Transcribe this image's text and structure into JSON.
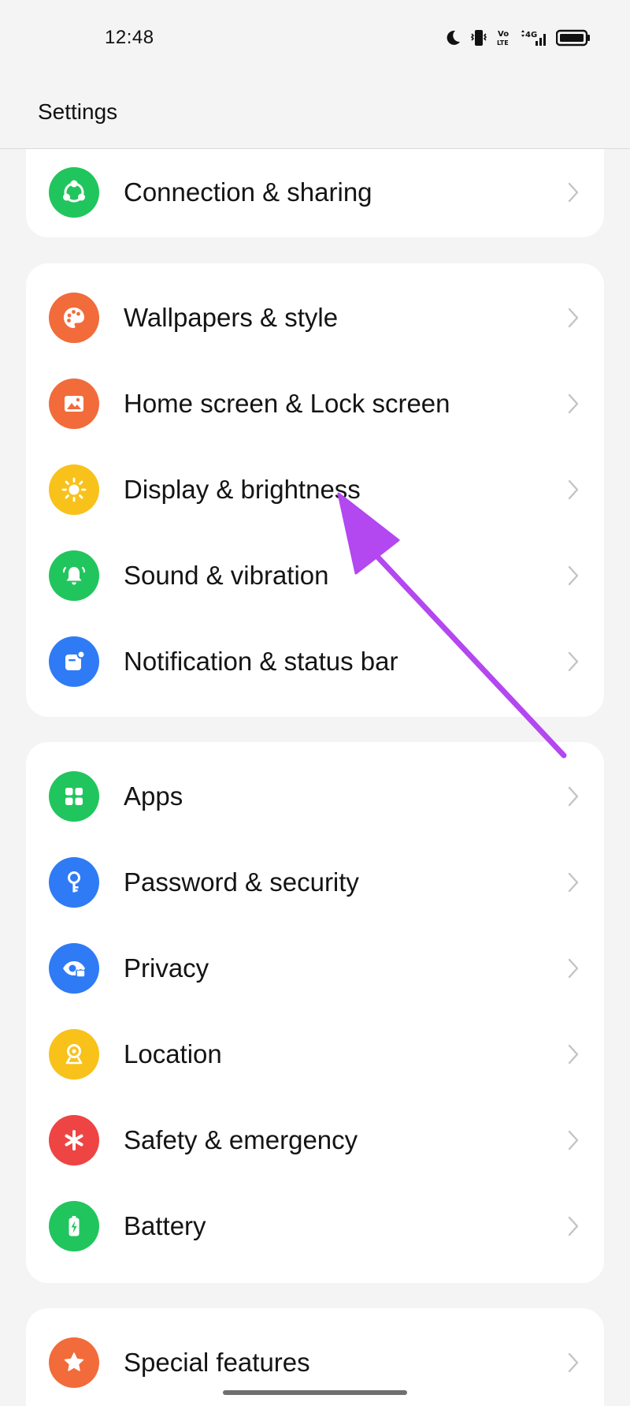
{
  "status_bar": {
    "time": "12:48",
    "icons": [
      "moon-icon",
      "vibrate-icon",
      "volte-icon",
      "signal-4g-icon",
      "battery-icon"
    ],
    "volte_text": "Vo\nLTE",
    "network_text": "4G"
  },
  "header": {
    "title": "Settings"
  },
  "groups": [
    {
      "items": [
        {
          "label": "Connection & sharing",
          "icon": "connection-sharing-icon",
          "color": "#21c55d"
        }
      ]
    },
    {
      "items": [
        {
          "label": "Wallpapers & style",
          "icon": "palette-icon",
          "color": "#f26b3a"
        },
        {
          "label": "Home screen & Lock screen",
          "icon": "image-icon",
          "color": "#f26b3a"
        },
        {
          "label": "Display & brightness",
          "icon": "sun-icon",
          "color": "#f8c21b"
        },
        {
          "label": "Sound & vibration",
          "icon": "bell-icon",
          "color": "#21c55d"
        },
        {
          "label": "Notification & status bar",
          "icon": "notification-icon",
          "color": "#2f7bf5"
        }
      ]
    },
    {
      "items": [
        {
          "label": "Apps",
          "icon": "apps-grid-icon",
          "color": "#21c55d"
        },
        {
          "label": "Password & security",
          "icon": "key-icon",
          "color": "#2f7bf5"
        },
        {
          "label": "Privacy",
          "icon": "eye-lock-icon",
          "color": "#2f7bf5"
        },
        {
          "label": "Location",
          "icon": "location-pin-icon",
          "color": "#f8c21b"
        },
        {
          "label": "Safety & emergency",
          "icon": "asterisk-icon",
          "color": "#ee4444"
        },
        {
          "label": "Battery",
          "icon": "battery-charge-icon",
          "color": "#21c55d"
        }
      ]
    },
    {
      "items": [
        {
          "label": "Special features",
          "icon": "star-icon",
          "color": "#f26b3a"
        }
      ]
    }
  ],
  "colors": {
    "background": "#f4f4f4",
    "card": "#ffffff",
    "annotation_arrow": "#b347f0",
    "chevron": "#c4c4c4"
  }
}
